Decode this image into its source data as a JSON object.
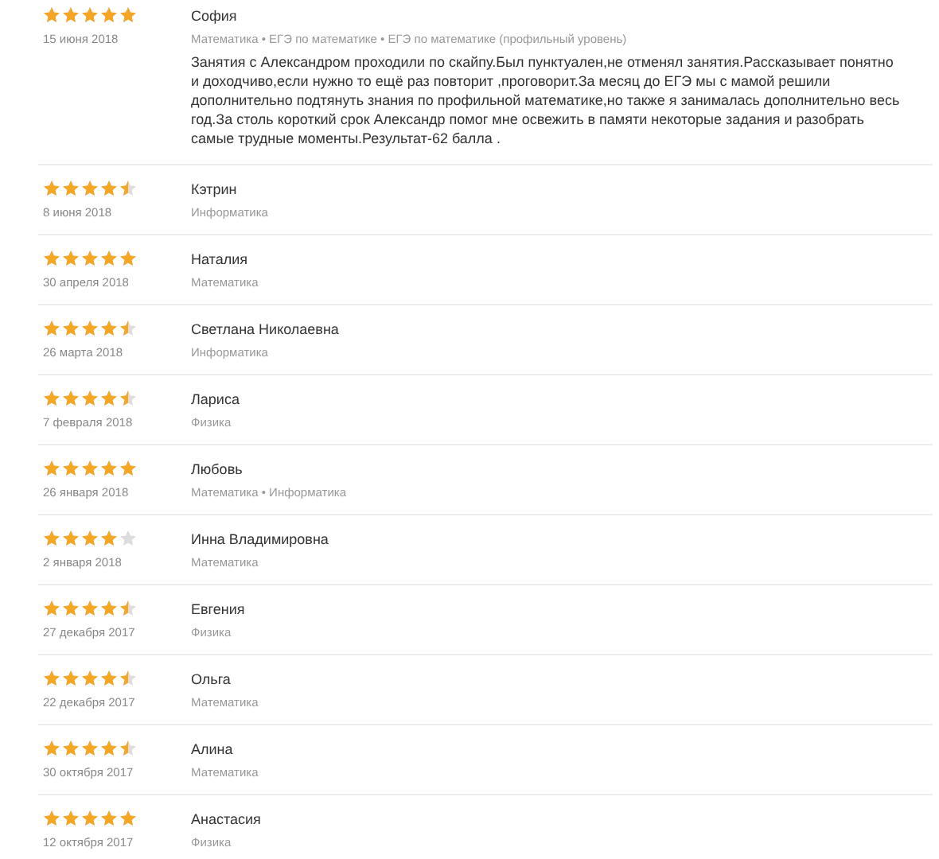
{
  "reviews": [
    {
      "stars": 5,
      "date": "15 июня 2018",
      "author": "София",
      "subjects": "Математика • ЕГЭ по математике • ЕГЭ по математике (профильный уровень)",
      "text": "Занятия с Александром проходили по скайпу.Был пунктуален,не отменял занятия.Рассказывает понятно и доходчиво,если нужно то ещё раз повторит ,проговорит.За месяц до ЕГЭ мы с мамой решили дополнительно подтянуть знания по профильной математике,но также я занималась дополнительно весь год.За столь короткий срок Александр помог мне освежить в памяти некоторые задания и разобрать самые трудные моменты.Результат-62 балла ."
    },
    {
      "stars": 4.5,
      "date": "8 июня 2018",
      "author": "Кэтрин",
      "subjects": "Информатика"
    },
    {
      "stars": 5,
      "date": "30 апреля 2018",
      "author": "Наталия",
      "subjects": "Математика"
    },
    {
      "stars": 4.5,
      "date": "26 марта 2018",
      "author": "Светлана Николаевна",
      "subjects": "Информатика"
    },
    {
      "stars": 4.5,
      "date": "7 февраля 2018",
      "author": "Лариса",
      "subjects": "Физика"
    },
    {
      "stars": 5,
      "date": "26 января 2018",
      "author": "Любовь",
      "subjects": "Математика • Информатика"
    },
    {
      "stars": 4,
      "date": "2 января 2018",
      "author": "Инна Владимировна",
      "subjects": "Математика"
    },
    {
      "stars": 4.5,
      "date": "27 декабря 2017",
      "author": "Евгения",
      "subjects": "Физика"
    },
    {
      "stars": 4.5,
      "date": "22 декабря 2017",
      "author": "Ольга",
      "subjects": "Математика"
    },
    {
      "stars": 4.5,
      "date": "30 октября 2017",
      "author": "Алина",
      "subjects": "Математика"
    },
    {
      "stars": 5,
      "date": "12 октября 2017",
      "author": "Анастасия",
      "subjects": "Физика"
    }
  ]
}
